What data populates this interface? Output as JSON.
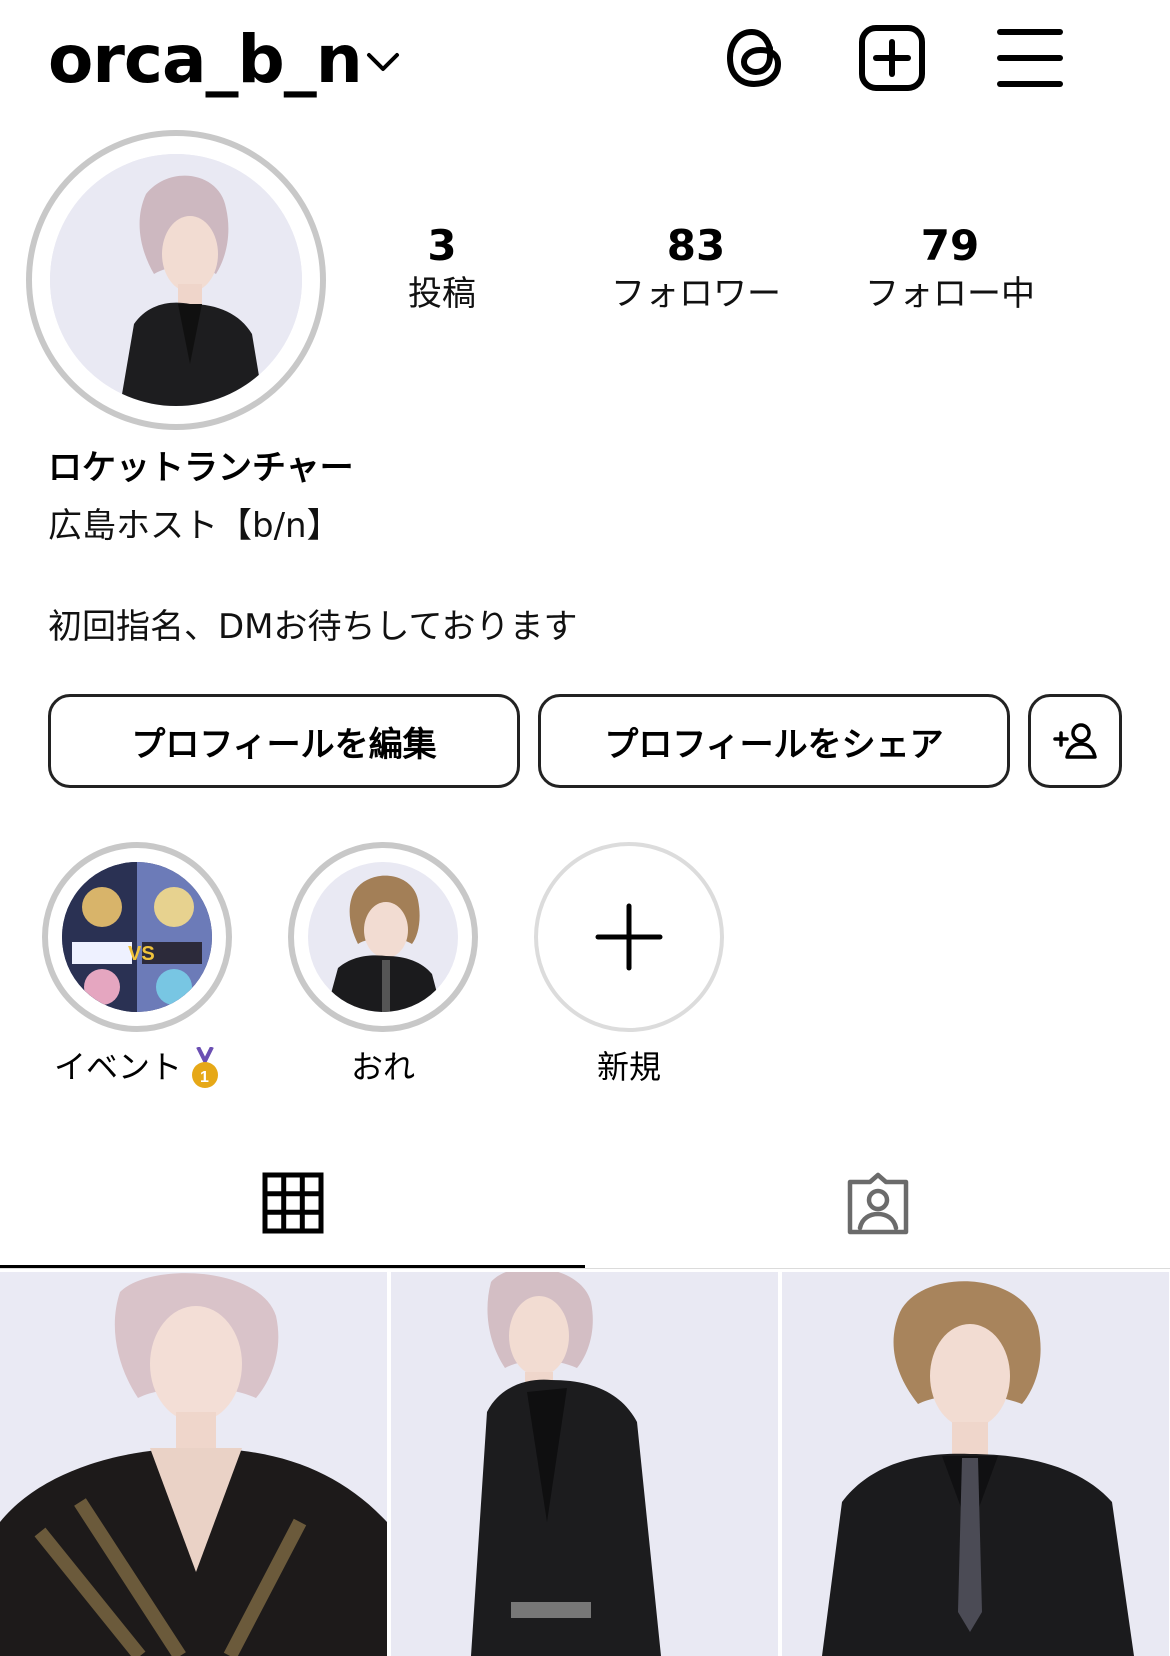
{
  "header": {
    "username": "orca_b_n",
    "username_chevron_icon": "chevron-down-icon",
    "icons": [
      "threads-icon",
      "create-post-icon",
      "menu-icon"
    ]
  },
  "profile": {
    "avatar_icon": "profile-photo",
    "stats": [
      {
        "value": "3",
        "label": "投稿"
      },
      {
        "value": "83",
        "label": "フォロワー"
      },
      {
        "value": "79",
        "label": "フォロー中"
      }
    ],
    "display_name": "ロケットランチャー",
    "category": "広島ホスト【b/n】",
    "bio": "初回指名、DMお待ちしております"
  },
  "buttons": {
    "edit": "プロフィールを編集",
    "share": "プロフィールをシェア",
    "add_icon": "add-person-icon"
  },
  "highlights": [
    {
      "label": "イベント",
      "icon": "medal-icon"
    },
    {
      "label": "おれ"
    },
    {
      "label": "新規",
      "icon": "plus-icon"
    }
  ],
  "tabs": {
    "items": [
      "grid-icon",
      "tagged-icon"
    ],
    "active": "grid-icon"
  },
  "colors": {
    "text": "#000000",
    "ring_gray": "#c8c8c8",
    "border": "#222222",
    "divider": "#dbdbdb",
    "photo_bg": "#e9e9f3",
    "medal_gold": "#e6a817"
  }
}
